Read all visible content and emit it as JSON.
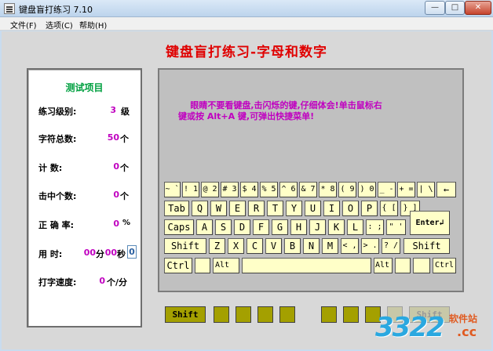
{
  "window": {
    "title": "键盘盲打练习 7.10",
    "min_glyph": "—",
    "max_glyph": "□",
    "close_glyph": "✕"
  },
  "menu": {
    "items": [
      {
        "label": "文件(F)"
      },
      {
        "label": "选项(C)"
      },
      {
        "label": "帮助(H)"
      }
    ]
  },
  "main": {
    "title": "键盘盲打练习-字母和数字",
    "hint_line1": "    眼睛不要看键盘,击闪烁的键,仔细体会!单击鼠标右",
    "hint_line2": "键或按 Alt+A 键,可弹出快捷菜单!"
  },
  "stats": {
    "title": "测试项目",
    "level_label": "练习级别:",
    "level_value": "3",
    "level_unit": "级",
    "total_label": "字符总数:",
    "total_value": "50",
    "total_unit": "个",
    "count_label": "计    数:",
    "count_value": "0",
    "count_unit": "个",
    "hit_label": "击中个数:",
    "hit_value": "0",
    "hit_unit": "个",
    "accuracy_label": "正 确 率:",
    "accuracy_value": "0",
    "accuracy_unit": "%",
    "time_label": "用    时:",
    "time_min": "00",
    "time_min_unit": "分",
    "time_sec": "00",
    "time_sec_unit": "秒",
    "time_box": "0",
    "speed_label": "打字速度:",
    "speed_value": "0",
    "speed_unit": "个/分"
  },
  "keyboard": {
    "row1": [
      "~ `",
      "! 1",
      "@ 2",
      "# 3",
      "$ 4",
      "% 5",
      "^ 6",
      "& 7",
      "* 8",
      "( 9",
      ") 0",
      "_ -",
      "+ =",
      "| \\",
      "←"
    ],
    "row2": [
      "Tab",
      "Q",
      "W",
      "E",
      "R",
      "T",
      "Y",
      "U",
      "I",
      "O",
      "P",
      "{ [",
      "} ]"
    ],
    "row3": [
      "Caps",
      "A",
      "S",
      "D",
      "F",
      "G",
      "H",
      "J",
      "K",
      "L",
      ": ;",
      "\" '",
      "Enter↲"
    ],
    "row4": [
      "Shift",
      "Z",
      "X",
      "C",
      "V",
      "B",
      "N",
      "M",
      "< ,",
      "> .",
      "? /",
      "Shift"
    ],
    "row5": [
      "Ctrl",
      "",
      "Alt",
      "",
      "Alt",
      "",
      "",
      "Ctrl"
    ]
  },
  "indicators": {
    "left_shift": "Shift",
    "right_shift": "Shift"
  },
  "watermark": {
    "number": "3322",
    "cn": "软件站",
    "domain": ".cc"
  },
  "colors": {
    "title_red": "#e00000",
    "stat_magenta": "#c000c0",
    "panel_green": "#00a040",
    "key_yellow": "#ffffc8",
    "indicator_olive": "#a4a000"
  }
}
